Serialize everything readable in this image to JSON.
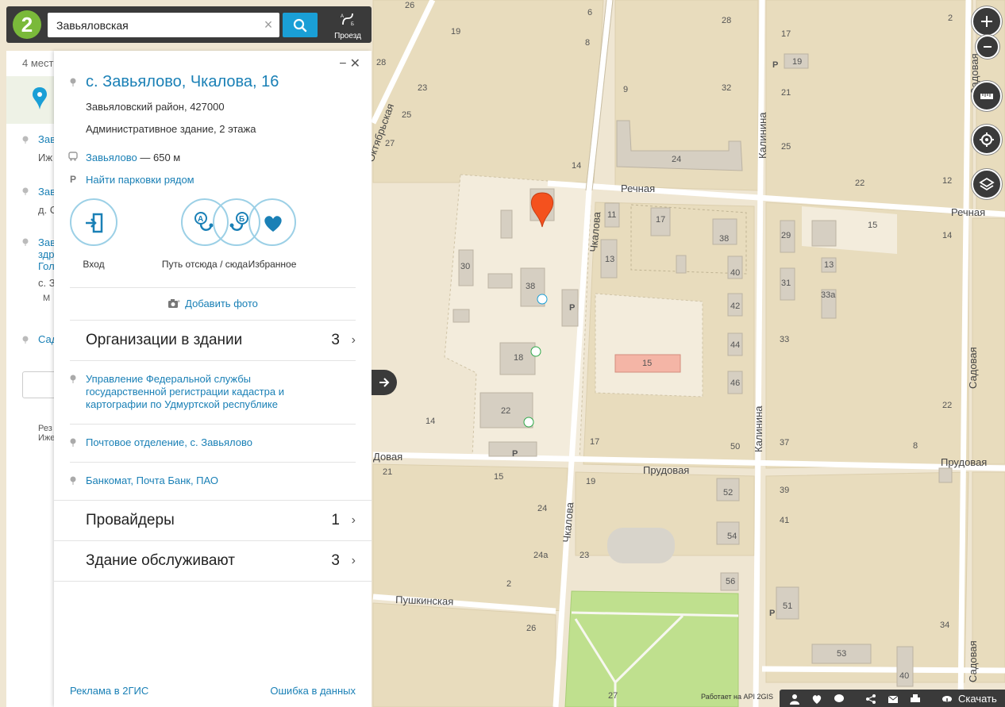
{
  "search": {
    "query": "Завьяловская",
    "route_label": "Проезд"
  },
  "results": {
    "count_label": "4 мест",
    "items": [
      {
        "title": "Зав",
        "sub": "Иж"
      },
      {
        "title": "Зав",
        "sub": "д. С"
      },
      {
        "title": "Зав",
        "title2": "здр",
        "title3": "Гол",
        "sub": "с. З",
        "sub2": "М"
      },
      {
        "title": "Сад"
      }
    ],
    "footer1": "Рез",
    "footer2": "Иже"
  },
  "card": {
    "title": "с. Завьялово, Чкалова, 16",
    "district": "Завьяловский район, 427000",
    "description": "Административное здание, 2 этажа",
    "transit_stop": "Завьялово",
    "transit_distance": " — 650 м",
    "parking_link": "Найти парковки рядом",
    "actions": [
      {
        "label": "Вход"
      },
      {
        "label": "Путь отсюда / сюда"
      },
      {
        "label": "Избранное"
      }
    ],
    "add_photo": "Добавить фото",
    "sections": {
      "orgs": {
        "title": "Организации в здании",
        "count": "3"
      },
      "providers": {
        "title": "Провайдеры",
        "count": "1"
      },
      "service": {
        "title": "Здание обслуживают",
        "count": "3"
      }
    },
    "organizations": [
      "Управление Федеральной службы государственной регистрации кадастра и картографии по Удмуртской республике",
      "Почтовое отделение, с. Завьялово",
      "Банкомат, Почта Банк, ПАО"
    ],
    "footer_ads": "Реклама в 2ГИС",
    "footer_error": "Ошибка в данных"
  },
  "map": {
    "streets": [
      "Речная",
      "Речная",
      "Чкалова",
      "Чкалова",
      "Калинина",
      "Калинина",
      "Садовая",
      "Садовая",
      "Прудовая",
      "Прудовая",
      "Прудовая",
      "Пушкинская",
      "Октябрьская"
    ],
    "house_numbers": [
      "26",
      "6",
      "8",
      "19",
      "28",
      "23",
      "25",
      "27",
      "29",
      "9",
      "32",
      "17",
      "19",
      "21",
      "25",
      "22",
      "12",
      "2",
      "14",
      "24",
      "11",
      "17",
      "38",
      "29",
      "15",
      "14",
      "13",
      "13",
      "30",
      "38",
      "40",
      "31",
      "33а",
      "42",
      "44",
      "33",
      "18",
      "15",
      "46",
      "22",
      "14",
      "22",
      "17",
      "50",
      "37",
      "8",
      "21",
      "15",
      "19",
      "52",
      "39",
      "24",
      "24а",
      "23",
      "54",
      "41",
      "2",
      "56",
      "51",
      "26",
      "34",
      "53",
      "27",
      "40"
    ],
    "parking_marks": [
      "P",
      "P",
      "P",
      "P"
    ],
    "colors": {
      "land": "#efe6d2",
      "block": "#e8dcbd",
      "road": "#ffffff",
      "building": "#d6cfc2",
      "park": "#bfe08e",
      "accent": "#1a9fd6",
      "pin": "#f4511e"
    }
  },
  "bottom": {
    "download": "Скачать",
    "copyright": "Работает на API 2GIS"
  },
  "icons": [
    "logo-icon",
    "clear-icon",
    "search-icon",
    "route-icon",
    "pin-icon",
    "bus-icon",
    "parking-icon",
    "entrance-icon",
    "route-ab-icon",
    "heart-icon",
    "camera-icon",
    "chevron-right-icon",
    "zoom-in-icon",
    "zoom-out-icon",
    "ruler-icon",
    "locate-icon",
    "layers-icon",
    "share-icon",
    "mail-icon",
    "print-icon",
    "download-icon",
    "arrow-right-icon"
  ]
}
